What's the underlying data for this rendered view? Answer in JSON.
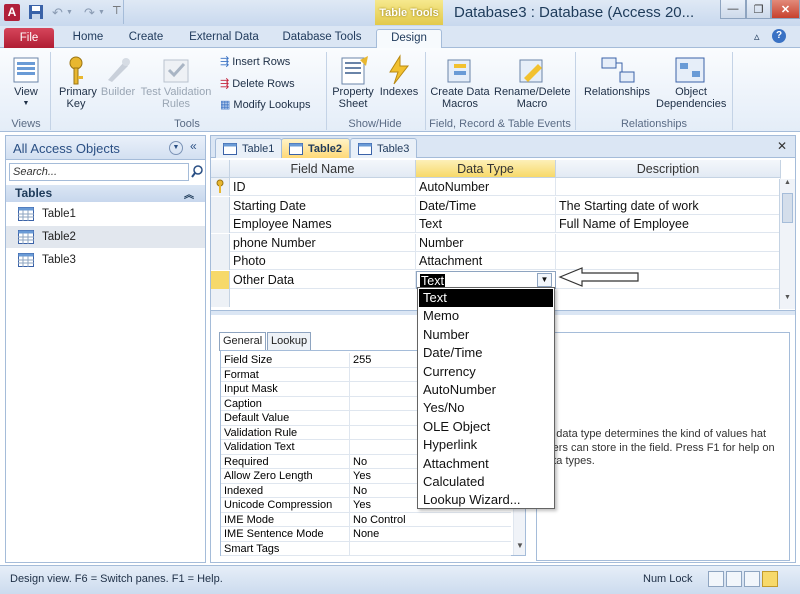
{
  "window": {
    "title": "Database3 : Database (Access 20...",
    "context_tab": "Table Tools"
  },
  "ribbon_tabs": [
    "File",
    "Home",
    "Create",
    "External Data",
    "Database Tools",
    "Design"
  ],
  "ribbon": {
    "views": {
      "view": "View",
      "group": "Views"
    },
    "tools": {
      "primary_key": "Primary Key",
      "builder": "Builder",
      "test_validation_rules": "Test Validation Rules",
      "insert_rows": "Insert Rows",
      "delete_rows": "Delete Rows",
      "modify_lookups": "Modify Lookups",
      "group": "Tools"
    },
    "show_hide": {
      "property_sheet": "Property Sheet",
      "indexes": "Indexes",
      "group": "Show/Hide"
    },
    "events": {
      "create_data_macros": "Create Data Macros",
      "rename_delete_macro": "Rename/Delete Macro",
      "group": "Field, Record & Table Events"
    },
    "relationships": {
      "relationships": "Relationships",
      "object_dependencies": "Object Dependencies",
      "group": "Relationships"
    }
  },
  "nav_pane": {
    "title": "All Access Objects",
    "search_placeholder": "Search...",
    "group": "Tables",
    "items": [
      "Table1",
      "Table2",
      "Table3"
    ],
    "selected": "Table2"
  },
  "doc_tabs": [
    "Table1",
    "Table2",
    "Table3"
  ],
  "active_doc_tab": "Table2",
  "grid": {
    "headers": {
      "field_name": "Field Name",
      "data_type": "Data Type",
      "description": "Description"
    },
    "rows": [
      {
        "field": "ID",
        "type": "AutoNumber",
        "desc": "",
        "key": true
      },
      {
        "field": "Starting Date",
        "type": "Date/Time",
        "desc": "The Starting date of work"
      },
      {
        "field": "Employee Names",
        "type": "Text",
        "desc": "Full Name of Employee"
      },
      {
        "field": "phone Number",
        "type": "Number",
        "desc": ""
      },
      {
        "field": "Photo",
        "type": "Attachment",
        "desc": ""
      },
      {
        "field": "Other Data",
        "type": "Text",
        "desc": "",
        "current": true
      }
    ]
  },
  "dropdown_options": [
    "Text",
    "Memo",
    "Number",
    "Date/Time",
    "Currency",
    "AutoNumber",
    "Yes/No",
    "OLE Object",
    "Hyperlink",
    "Attachment",
    "Calculated",
    "Lookup Wizard..."
  ],
  "dropdown_selected": "Text",
  "field_properties": {
    "tabs": [
      "General",
      "Lookup"
    ],
    "rows": [
      {
        "k": "Field Size",
        "v": "255"
      },
      {
        "k": "Format",
        "v": ""
      },
      {
        "k": "Input Mask",
        "v": ""
      },
      {
        "k": "Caption",
        "v": ""
      },
      {
        "k": "Default Value",
        "v": ""
      },
      {
        "k": "Validation Rule",
        "v": ""
      },
      {
        "k": "Validation Text",
        "v": ""
      },
      {
        "k": "Required",
        "v": "No"
      },
      {
        "k": "Allow Zero Length",
        "v": "Yes"
      },
      {
        "k": "Indexed",
        "v": "No"
      },
      {
        "k": "Unicode Compression",
        "v": "Yes"
      },
      {
        "k": "IME Mode",
        "v": "No Control"
      },
      {
        "k": "IME Sentence Mode",
        "v": "None"
      },
      {
        "k": "Smart Tags",
        "v": ""
      }
    ],
    "help_text": "he data type determines the kind of values hat users can store in the field. Press F1 for help on data types."
  },
  "status": {
    "left": "Design view.  F6 = Switch panes.  F1 = Help.",
    "num_lock": "Num Lock"
  },
  "colors": {
    "file_tab": "#c4233b",
    "context_tab": "#e9d25c",
    "active_tab": "#ffd978",
    "selection": "#000000"
  }
}
